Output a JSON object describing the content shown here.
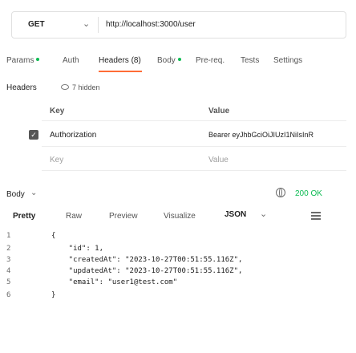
{
  "request": {
    "method": "GET",
    "url": "http://localhost:3000/user"
  },
  "tabs": [
    {
      "label": "Params",
      "dot": true
    },
    {
      "label": "Auth"
    },
    {
      "label": "Headers (8)",
      "active": true
    },
    {
      "label": "Body",
      "dot": true
    },
    {
      "label": "Pre-req."
    },
    {
      "label": "Tests"
    },
    {
      "label": "Settings"
    }
  ],
  "headers_section": {
    "label": "Headers",
    "hidden_toggle": "7 hidden",
    "col_key": "Key",
    "col_value": "Value",
    "rows": [
      {
        "key": "Authorization",
        "value": "Bearer eyJhbGciOiJIUzI1NiIsInR",
        "checked": true
      }
    ],
    "placeholder_key": "Key",
    "placeholder_value": "Value"
  },
  "response": {
    "body_label": "Body",
    "status": "200 OK",
    "tabs": [
      "Pretty",
      "Raw",
      "Preview",
      "Visualize"
    ],
    "active_tab": "Pretty",
    "format": "JSON",
    "lines": [
      {
        "n": "1",
        "text": "{"
      },
      {
        "n": "2",
        "text": "    \"id\": 1,"
      },
      {
        "n": "3",
        "text": "    \"createdAt\": \"2023-10-27T00:51:55.116Z\","
      },
      {
        "n": "4",
        "text": "    \"updatedAt\": \"2023-10-27T00:51:55.116Z\","
      },
      {
        "n": "5",
        "text": "    \"email\": \"user1@test.com\""
      },
      {
        "n": "6",
        "text": "}"
      }
    ]
  },
  "colors": {
    "accent": "#ff6c37",
    "status_ok": "#0cbb52"
  }
}
